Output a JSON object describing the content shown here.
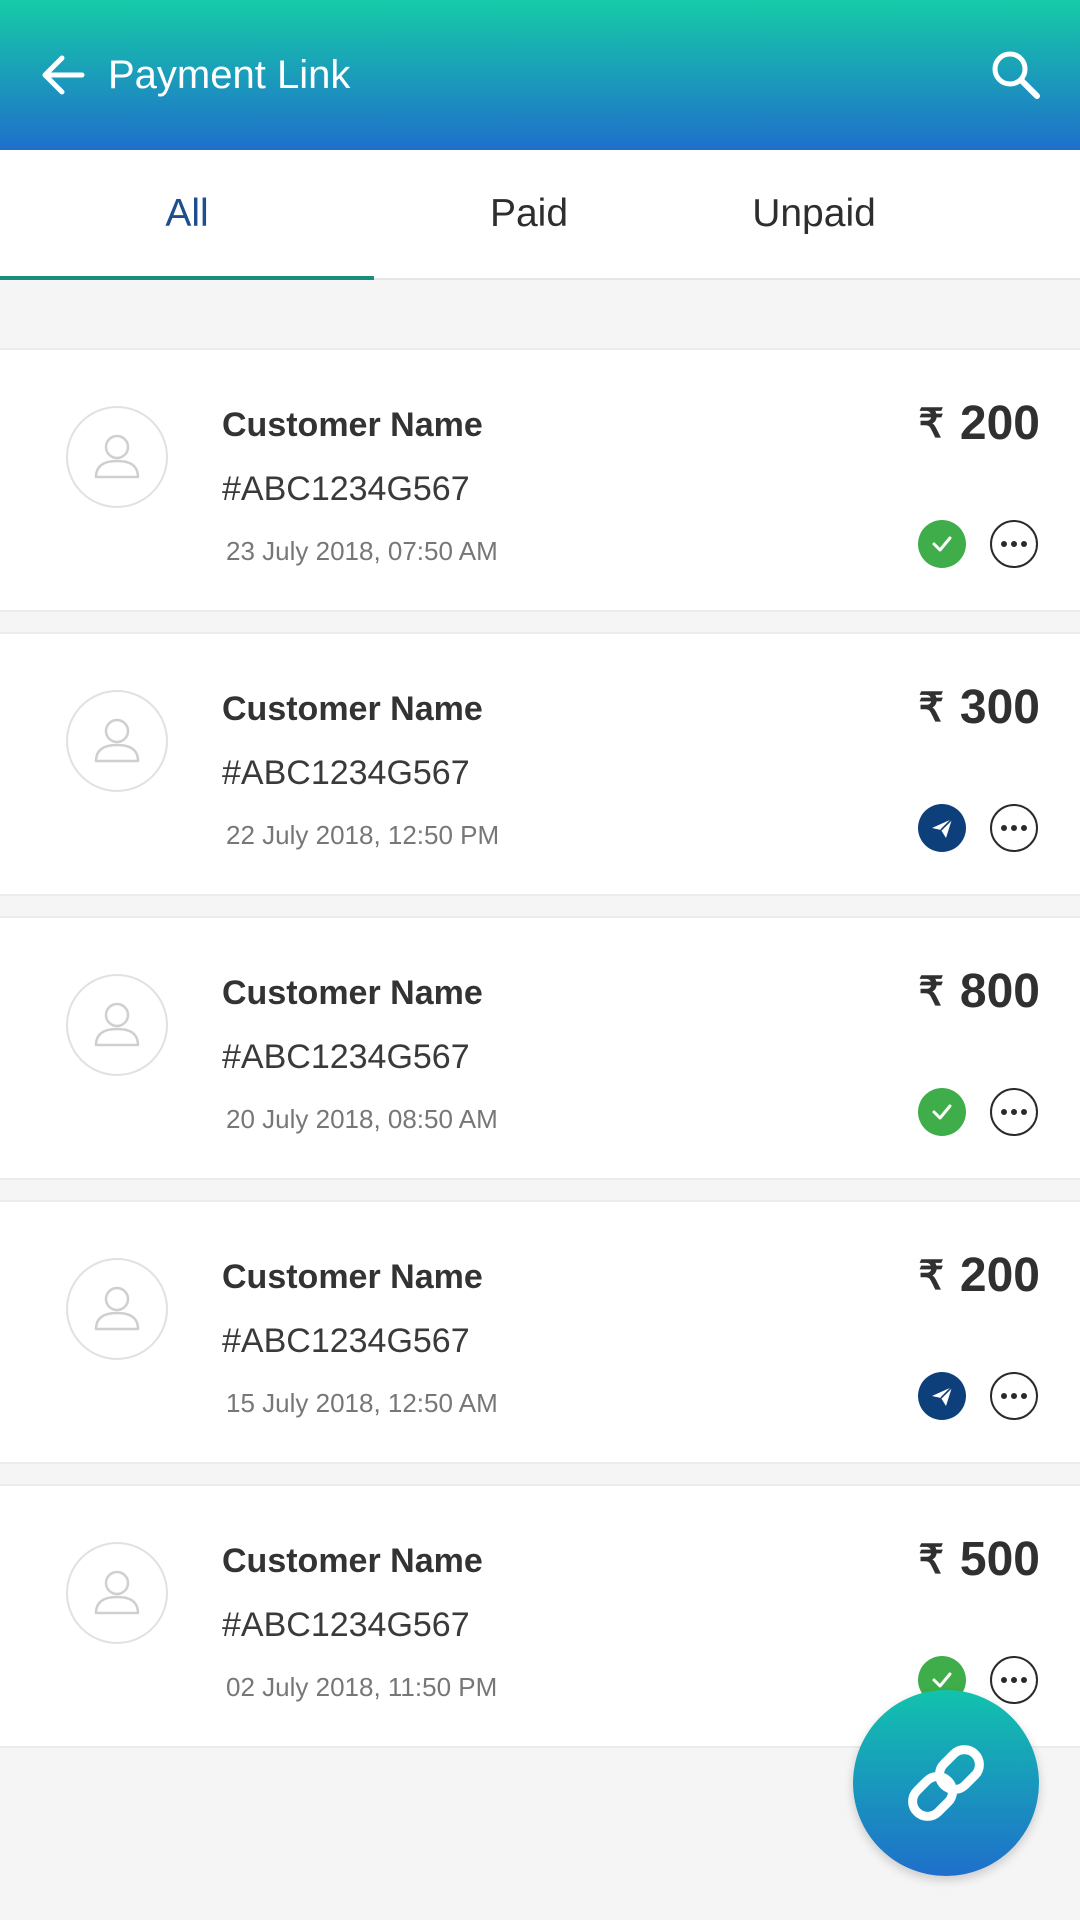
{
  "appbar": {
    "title": "Payment Link",
    "back_icon": "arrow-left-icon",
    "search_icon": "search-icon",
    "gradient": [
      "#16cba8",
      "#1f6fcb"
    ]
  },
  "tabs": [
    {
      "label": "All",
      "active": true
    },
    {
      "label": "Paid",
      "active": false
    },
    {
      "label": "Unpaid",
      "active": false
    }
  ],
  "currency_symbol": "₹",
  "transactions": [
    {
      "name": "Customer Name",
      "code": "#ABC1234G567",
      "date": "23 July 2018, 07:50 AM",
      "amount": "200",
      "status": "paid"
    },
    {
      "name": "Customer Name",
      "code": "#ABC1234G567",
      "date": "22 July 2018, 12:50 PM",
      "amount": "300",
      "status": "sent"
    },
    {
      "name": "Customer Name",
      "code": "#ABC1234G567",
      "date": "20 July 2018, 08:50 AM",
      "amount": "800",
      "status": "paid"
    },
    {
      "name": "Customer Name",
      "code": "#ABC1234G567",
      "date": "15 July 2018, 12:50 AM",
      "amount": "200",
      "status": "sent"
    },
    {
      "name": "Customer Name",
      "code": "#ABC1234G567",
      "date": "02 July 2018, 11:50 PM",
      "amount": "500",
      "status": "paid"
    }
  ],
  "fab": {
    "icon": "link-icon"
  },
  "colors": {
    "paid": "#3fae4a",
    "sent": "#0d3f7a",
    "active_tab": "#1b4f8d",
    "indicator": "#1a8e7a"
  }
}
